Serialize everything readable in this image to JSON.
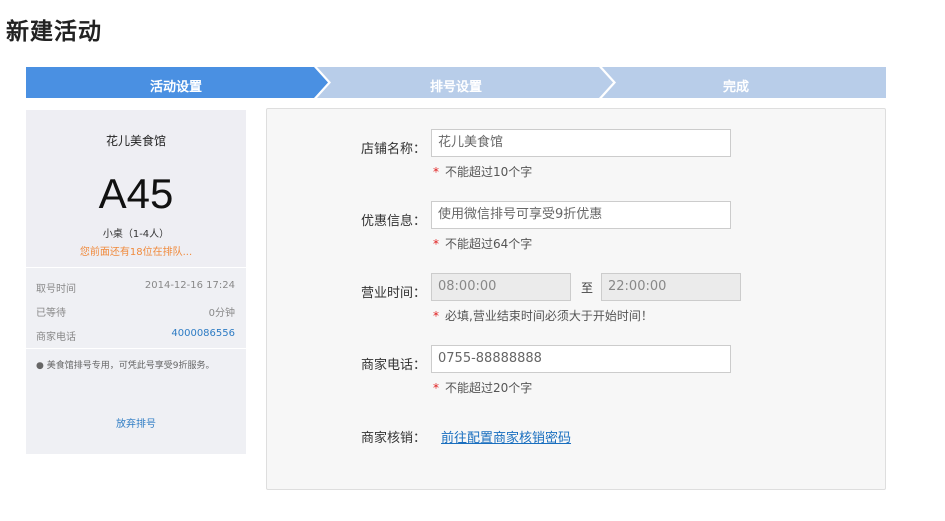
{
  "page": {
    "title": "新建活动"
  },
  "steps": [
    {
      "label": "活动设置",
      "active": true,
      "color": "#4a90e2"
    },
    {
      "label": "排号设置",
      "active": false,
      "color": "#b8cde9"
    },
    {
      "label": "完成",
      "active": false,
      "color": "#b8cde9"
    }
  ],
  "preview": {
    "shop_name": "花儿美食馆",
    "number": "A45",
    "table_type": "小桌（1-4人）",
    "queue_info": "您前面还有18位在排队...",
    "rows": [
      {
        "label": "取号时间",
        "value": "2014-12-16 17:24"
      },
      {
        "label": "已等待",
        "value": "0分钟"
      },
      {
        "label": "商家电话",
        "value": "4000086556"
      }
    ],
    "note": "● 美食馆排号专用，可凭此号享受9折服务。",
    "cancel_label": "放弃排号"
  },
  "form": {
    "shop_name": {
      "label": "店铺名称：",
      "value": "花儿美食馆",
      "hint": "不能超过10个字"
    },
    "offer": {
      "label": "优惠信息：",
      "value": "使用微信排号可享受9折优惠",
      "hint": "不能超过64个字"
    },
    "hours": {
      "label": "营业时间：",
      "start": "08:00:00",
      "separator": "至",
      "end": "22:00:00",
      "hint": "必填,营业结束时间必须大于开始时间！"
    },
    "phone": {
      "label": "商家电话：",
      "value": "0755-88888888",
      "hint": "不能超过20个字"
    },
    "verify": {
      "label": "商家核销：",
      "link": "前往配置商家核销密码"
    },
    "required_mark": "*"
  }
}
